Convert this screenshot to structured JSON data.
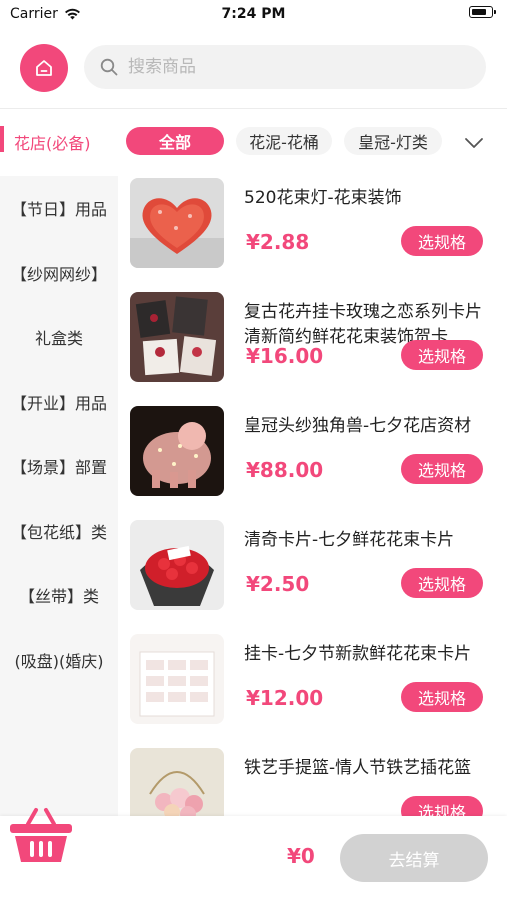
{
  "status_bar": {
    "carrier": "Carrier",
    "time": "7:24 PM",
    "icons": [
      "wifi-icon",
      "battery-icon"
    ]
  },
  "header": {
    "home_icon": "home-icon",
    "search_icon": "search-icon",
    "search_placeholder": "搜索商品"
  },
  "category_bar": {
    "current_category": "花店(必备)",
    "chips": [
      "全部",
      "花泥-花桶",
      "皇冠-灯类"
    ],
    "selected_chip": "全部",
    "expand_icon": "chevron-down-icon"
  },
  "sidebar": {
    "items": [
      "【节日】用品",
      "【纱网网纱】",
      "礼盒类",
      "【开业】用品",
      "【场景】部置",
      "【包花纸】类",
      "【丝带】类",
      "(吸盘)(婚庆)"
    ]
  },
  "products": [
    {
      "name": "520花束灯-花束装饰",
      "price": "¥2.88",
      "button": "选规格",
      "image": "heart-rose-bouquet"
    },
    {
      "name": "复古花卉挂卡玫瑰之恋系列卡片清新简约鲜花花束装饰贺卡",
      "price": "¥16.00",
      "button": "选规格",
      "image": "greeting-cards"
    },
    {
      "name": "皇冠头纱独角兽-七夕花店资材",
      "price": "¥88.00",
      "button": "选规格",
      "image": "glowing-unicorn"
    },
    {
      "name": "清奇卡片-七夕鲜花花束卡片",
      "price": "¥2.50",
      "button": "选规格",
      "image": "red-rose-bouquet"
    },
    {
      "name": "挂卡-七夕节新款鲜花花束卡片",
      "price": "¥12.00",
      "button": "选规格",
      "image": "hanging-cards"
    },
    {
      "name": "铁艺手提篮-情人节铁艺插花篮",
      "price": "",
      "button": "选规格",
      "image": "flower-basket"
    }
  ],
  "bottom_bar": {
    "cart_icon": "shopping-basket-icon",
    "total": "¥0",
    "checkout": "去结算"
  },
  "colors": {
    "accent": "#f2487b",
    "sidebar_bg": "#f6f6f6",
    "disabled_button": "#d2d2d2"
  }
}
